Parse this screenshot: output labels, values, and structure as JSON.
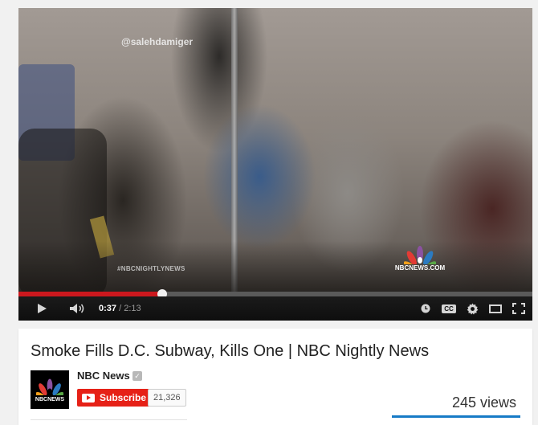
{
  "video": {
    "watermark": "@salehdamiger",
    "hashtag": "#NBCNIGHTLYNEWS",
    "overlay_domain": "NBCNEWS.COM",
    "progress_fraction": 0.28,
    "current_time": "0:37",
    "separator": " / ",
    "duration": "2:13",
    "cc_label": "CC"
  },
  "info": {
    "title": "Smoke Fills D.C. Subway, Kills One | NBC Nightly News",
    "channel_name": "NBC News",
    "logo_text": "NBCNEWS",
    "subscribe_label": "Subscribe",
    "subscriber_count": "21,326",
    "views": "245 views"
  },
  "colors": {
    "progress_played": "#cc181e",
    "subscribe_red": "#e62117",
    "sentiment_blue": "#167ac6"
  },
  "icons": [
    "play-icon",
    "volume-icon",
    "watch-later-icon",
    "captions-icon",
    "settings-icon",
    "theater-mode-icon",
    "fullscreen-icon",
    "peacock-icon",
    "verified-icon",
    "youtube-icon"
  ]
}
